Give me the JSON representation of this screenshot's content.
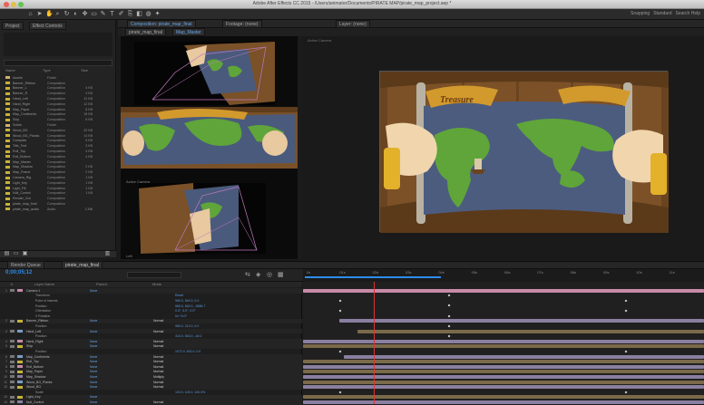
{
  "app": {
    "window_title": "Adobe After Effects CC 2015 - /Users/animator/Documents/PIRATE MAP/pirate_map_project.aep *",
    "workspace_label": "Standard"
  },
  "colors": {
    "accent_blue": "#2d8ceb",
    "layer_label_yellow": "#c6b23a",
    "bar_tan": "#7a6a4a",
    "bar_lavender": "#8a7fa0",
    "bar_pink": "#c98aa8"
  },
  "toolbar": {
    "tools": [
      "home-icon",
      "selection-icon",
      "hand-icon",
      "zoom-icon",
      "rotate-icon",
      "camera-icon",
      "pan-behind-icon",
      "rectangle-icon",
      "pen-icon",
      "type-icon",
      "brush-icon",
      "clone-icon",
      "eraser-icon",
      "roto-icon",
      "puppet-icon"
    ],
    "right_items": [
      "Snapping",
      "Standard",
      "Search Help"
    ]
  },
  "project_panel": {
    "tab_project": "Project",
    "tab_effects": "Effect Controls",
    "columns": [
      "Name",
      "Type",
      "Size"
    ],
    "items": [
      {
        "name": "Assets",
        "type": "Folder",
        "size": ""
      },
      {
        "name": "Banner_Ribbon",
        "type": "Composition",
        "size": ""
      },
      {
        "name": "Banner_L",
        "type": "Composition",
        "size": "4 KB"
      },
      {
        "name": "Banner_R",
        "type": "Composition",
        "size": "4 KB"
      },
      {
        "name": "Hand_Left",
        "type": "Composition",
        "size": "12 KB"
      },
      {
        "name": "Hand_Right",
        "type": "Composition",
        "size": "12 KB"
      },
      {
        "name": "Map_Paper",
        "type": "Composition",
        "size": "8 KB"
      },
      {
        "name": "Map_Continents",
        "type": "Composition",
        "size": "18 KB"
      },
      {
        "name": "Ship",
        "type": "Composition",
        "size": "6 KB"
      },
      {
        "name": "Solids",
        "type": "Folder",
        "size": ""
      },
      {
        "name": "Wood_BG",
        "type": "Composition",
        "size": "20 KB"
      },
      {
        "name": "Wood_BG_Planks",
        "type": "Composition",
        "size": "14 KB"
      },
      {
        "name": "Compass",
        "type": "Composition",
        "size": "5 KB"
      },
      {
        "name": "Title_Text",
        "type": "Composition",
        "size": "3 KB"
      },
      {
        "name": "Roll_Top",
        "type": "Composition",
        "size": "4 KB"
      },
      {
        "name": "Roll_Bottom",
        "type": "Composition",
        "size": "4 KB"
      },
      {
        "name": "Map_Master",
        "type": "Composition",
        "size": ""
      },
      {
        "name": "Map_Shadow",
        "type": "Composition",
        "size": "2 KB"
      },
      {
        "name": "Map_Frame",
        "type": "Composition",
        "size": "2 KB"
      },
      {
        "name": "Camera_Rig",
        "type": "Composition",
        "size": "1 KB"
      },
      {
        "name": "Light_Key",
        "type": "Composition",
        "size": "1 KB"
      },
      {
        "name": "Light_Fill",
        "type": "Composition",
        "size": "1 KB"
      },
      {
        "name": "Null_Control",
        "type": "Composition",
        "size": "1 KB"
      },
      {
        "name": "Render_Out",
        "type": "Composition",
        "size": ""
      },
      {
        "name": "pirate_map_final",
        "type": "Composition",
        "size": ""
      },
      {
        "name": "pirate_map_audio",
        "type": "Audio",
        "size": "2 MB"
      }
    ]
  },
  "views": {
    "tab_composition": "Composition: pirate_map_final",
    "tab_footage": "Footage: (none)",
    "tab_layer": "Layer: (none)",
    "sub_tabs": [
      "pirate_map_final",
      "Map_Master"
    ],
    "left_view_labels": [
      "Top",
      "Active Camera",
      "Left"
    ],
    "right_view_label": "Active Camera",
    "banner_text": "Treasure"
  },
  "timeline": {
    "tabs": [
      "Render Queue",
      "pirate_map_final"
    ],
    "timecode": "0;00;05;12",
    "search_placeholder": "Search",
    "columns": [
      "#",
      "Layer Name",
      "Parent",
      "Mode"
    ],
    "ruler_ticks": [
      "0s",
      "01s",
      "02s",
      "03s",
      "04s",
      "05s",
      "06s",
      "07s",
      "08s",
      "09s",
      "10s",
      "11s"
    ],
    "layers": [
      {
        "idx": "1",
        "name": "Camera 1",
        "parent": "None",
        "mode": "",
        "vals": ""
      },
      {
        "idx": "",
        "name": "Transform",
        "parent": "",
        "mode": "",
        "vals": "Reset"
      },
      {
        "idx": "",
        "name": "Point of Interest",
        "parent": "",
        "mode": "",
        "vals": "960.0, 540.0, 0.0"
      },
      {
        "idx": "",
        "name": "Position",
        "parent": "",
        "mode": "",
        "vals": "960.0, 540.0, -2666.7"
      },
      {
        "idx": "",
        "name": "Orientation",
        "parent": "",
        "mode": "",
        "vals": "0.0°, 0.0°, 0.0°"
      },
      {
        "idx": "",
        "name": "X Rotation",
        "parent": "",
        "mode": "",
        "vals": "0x +0.0°"
      },
      {
        "idx": "2",
        "name": "Banner_Ribbon",
        "parent": "None",
        "mode": "Normal",
        "vals": ""
      },
      {
        "idx": "",
        "name": "Position",
        "parent": "",
        "mode": "",
        "vals": "960.0, 212.0, 0.0"
      },
      {
        "idx": "3",
        "name": "Hand_Left",
        "parent": "None",
        "mode": "Normal",
        "vals": ""
      },
      {
        "idx": "",
        "name": "Position",
        "parent": "",
        "mode": "",
        "vals": "310.0, 540.0, -40.0"
      },
      {
        "idx": "4",
        "name": "Hand_Right",
        "parent": "None",
        "mode": "Normal",
        "vals": ""
      },
      {
        "idx": "5",
        "name": "Ship",
        "parent": "None",
        "mode": "Normal",
        "vals": ""
      },
      {
        "idx": "",
        "name": "Position",
        "parent": "",
        "mode": "",
        "vals": "1072.0, 602.0, 0.0"
      },
      {
        "idx": "6",
        "name": "Map_Continents",
        "parent": "None",
        "mode": "Normal",
        "vals": ""
      },
      {
        "idx": "7",
        "name": "Roll_Top",
        "parent": "None",
        "mode": "Normal",
        "vals": ""
      },
      {
        "idx": "8",
        "name": "Roll_Bottom",
        "parent": "None",
        "mode": "Normal",
        "vals": ""
      },
      {
        "idx": "9",
        "name": "Map_Paper",
        "parent": "None",
        "mode": "Normal",
        "vals": ""
      },
      {
        "idx": "10",
        "name": "Map_Shadow",
        "parent": "None",
        "mode": "Multiply",
        "vals": ""
      },
      {
        "idx": "11",
        "name": "Wood_BG_Planks",
        "parent": "None",
        "mode": "Normal",
        "vals": ""
      },
      {
        "idx": "12",
        "name": "Wood_BG",
        "parent": "None",
        "mode": "Normal",
        "vals": ""
      },
      {
        "idx": "",
        "name": "Scale",
        "parent": "",
        "mode": "",
        "vals": "100.0, 100.0, 100.0%"
      },
      {
        "idx": "13",
        "name": "Light_Key",
        "parent": "None",
        "mode": "",
        "vals": ""
      },
      {
        "idx": "14",
        "name": "Null_Control",
        "parent": "None",
        "mode": "Normal",
        "vals": ""
      }
    ]
  }
}
